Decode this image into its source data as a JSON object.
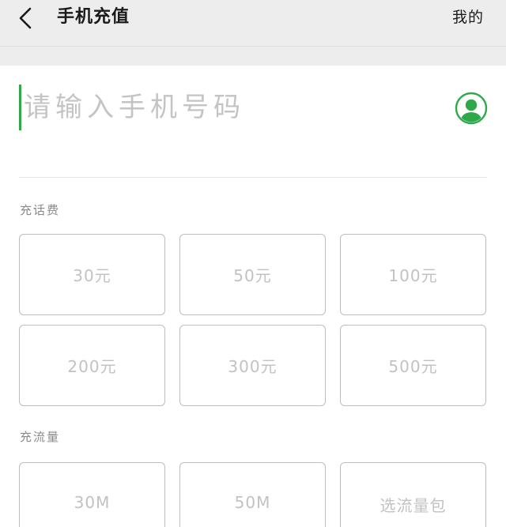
{
  "header": {
    "title": "手机充值",
    "right_link": "我的"
  },
  "phone": {
    "placeholder": "请输入手机号码",
    "value": ""
  },
  "colors": {
    "accent": "#2fa84a",
    "header_bg": "#ededed"
  },
  "sections": {
    "call_credit": {
      "label": "充话费",
      "options": [
        "30元",
        "50元",
        "100元",
        "200元",
        "300元",
        "500元"
      ]
    },
    "data_plan": {
      "label": "充流量",
      "options": [
        "30M",
        "50M",
        "选流量包"
      ]
    }
  },
  "icons": {
    "back": "chevron-left-icon",
    "contact": "contact-person-icon"
  }
}
